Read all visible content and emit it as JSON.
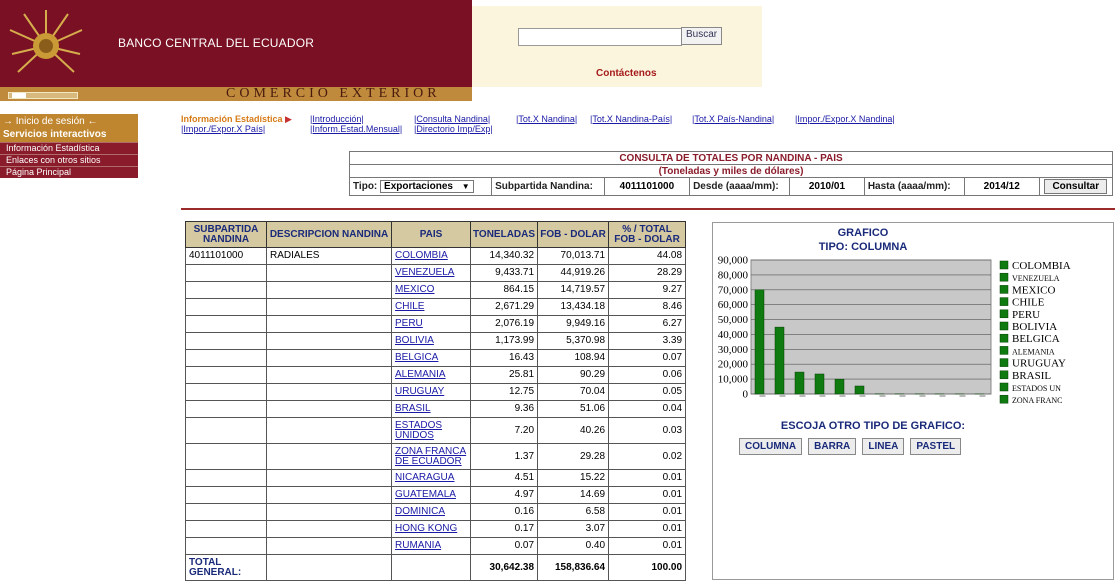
{
  "header": {
    "bank_name": "BANCO CENTRAL DEL ECUADOR",
    "search_button": "Buscar",
    "search_value": "",
    "contact": "Contáctenos",
    "section_title": "COMERCIO EXTERIOR"
  },
  "sidebar": {
    "login": "→ Inicio de sesión ←",
    "services": "Servicios interactivos",
    "items": [
      {
        "label": "Información Estadística"
      },
      {
        "label": "Enlaces con otros sitios"
      },
      {
        "label": "Página Principal"
      }
    ]
  },
  "nav": {
    "current": "Información Estadística",
    "links": {
      "introduccion": "|Introducción|",
      "consulta_nandina": "|Consulta Nandina|",
      "tot_nandina": "|Tot.X Nandina|",
      "tot_nandina_pais": "|Tot.X Nandina-País|",
      "tot_pais_nandina": "|Tot.X País-Nandina|",
      "impor_expor_nandina": "|Impor./Expor.X Nandina|",
      "impor_expor_pais": "|Impor./Expor.X País|",
      "inform_estad": "|Inform.Estad.Mensual|",
      "directorio": "|Directorio Imp/Exp|"
    }
  },
  "consulta": {
    "title": "CONSULTA DE TOTALES POR NANDINA - PAIS",
    "subtitle": "(Toneladas y miles de dólares)",
    "tipo_label": "Tipo:",
    "tipo_value": "Exportaciones",
    "subpartida_label": "Subpartida Nandina:",
    "subpartida_value": "4011101000",
    "desde_label": "Desde (aaaa/mm):",
    "desde_value": "2010/01",
    "hasta_label": "Hasta (aaaa/mm):",
    "hasta_value": "2014/12",
    "button": "Consultar"
  },
  "table": {
    "headers": [
      "SUBPARTIDA NANDINA",
      "DESCRIPCION NANDINA",
      "PAIS",
      "TONELADAS",
      "FOB - DOLAR",
      "% / TOTAL FOB - DOLAR"
    ],
    "rows": [
      {
        "sub": "4011101000",
        "desc": "RADIALES",
        "pais": "COLOMBIA",
        "ton": "14,340.32",
        "fob": "70,013.71",
        "pct": "44.08"
      },
      {
        "sub": "",
        "desc": "",
        "pais": "VENEZUELA",
        "ton": "9,433.71",
        "fob": "44,919.26",
        "pct": "28.29"
      },
      {
        "sub": "",
        "desc": "",
        "pais": "MEXICO",
        "ton": "864.15",
        "fob": "14,719.57",
        "pct": "9.27"
      },
      {
        "sub": "",
        "desc": "",
        "pais": "CHILE",
        "ton": "2,671.29",
        "fob": "13,434.18",
        "pct": "8.46"
      },
      {
        "sub": "",
        "desc": "",
        "pais": "PERU",
        "ton": "2,076.19",
        "fob": "9,949.16",
        "pct": "6.27"
      },
      {
        "sub": "",
        "desc": "",
        "pais": "BOLIVIA",
        "ton": "1,173.99",
        "fob": "5,370.98",
        "pct": "3.39"
      },
      {
        "sub": "",
        "desc": "",
        "pais": "BELGICA",
        "ton": "16.43",
        "fob": "108.94",
        "pct": "0.07"
      },
      {
        "sub": "",
        "desc": "",
        "pais": "ALEMANIA",
        "ton": "25.81",
        "fob": "90.29",
        "pct": "0.06"
      },
      {
        "sub": "",
        "desc": "",
        "pais": "URUGUAY",
        "ton": "12.75",
        "fob": "70.04",
        "pct": "0.05"
      },
      {
        "sub": "",
        "desc": "",
        "pais": "BRASIL",
        "ton": "9.36",
        "fob": "51.06",
        "pct": "0.04"
      },
      {
        "sub": "",
        "desc": "",
        "pais": "ESTADOS UNIDOS",
        "ton": "7.20",
        "fob": "40.26",
        "pct": "0.03"
      },
      {
        "sub": "",
        "desc": "",
        "pais": "ZONA FRANCA DE ECUADOR",
        "ton": "1.37",
        "fob": "29.28",
        "pct": "0.02"
      },
      {
        "sub": "",
        "desc": "",
        "pais": "NICARAGUA",
        "ton": "4.51",
        "fob": "15.22",
        "pct": "0.01"
      },
      {
        "sub": "",
        "desc": "",
        "pais": "GUATEMALA",
        "ton": "4.97",
        "fob": "14.69",
        "pct": "0.01"
      },
      {
        "sub": "",
        "desc": "",
        "pais": "DOMINICA",
        "ton": "0.16",
        "fob": "6.58",
        "pct": "0.01"
      },
      {
        "sub": "",
        "desc": "",
        "pais": "HONG KONG",
        "ton": "0.17",
        "fob": "3.07",
        "pct": "0.01"
      },
      {
        "sub": "",
        "desc": "",
        "pais": "RUMANIA",
        "ton": "0.07",
        "fob": "0.40",
        "pct": "0.01"
      }
    ],
    "total": {
      "label": "TOTAL GENERAL:",
      "ton": "30,642.38",
      "fob": "158,836.64",
      "pct": "100.00"
    }
  },
  "chart_panel": {
    "title": "GRAFICO",
    "subtitle": "TIPO: COLUMNA",
    "prompt": "ESCOJA OTRO TIPO DE GRAFICO:",
    "buttons": [
      "COLUMNA",
      "BARRA",
      "LINEA",
      "PASTEL"
    ]
  },
  "chart_data": {
    "type": "bar",
    "categories": [
      "COLOMBIA",
      "VENEZUELA",
      "MEXICO",
      "CHILE",
      "PERU",
      "BOLIVIA",
      "BELGICA",
      "ALEMANIA",
      "URUGUAY",
      "BRASIL",
      "ESTADOS UN",
      "ZONA FRANC"
    ],
    "values": [
      70013.71,
      44919.26,
      14719.57,
      13434.18,
      9949.16,
      5370.98,
      108.94,
      90.29,
      70.04,
      51.06,
      40.26,
      29.28
    ],
    "ylim": [
      0,
      90000
    ],
    "yticks": [
      "0",
      "10,000",
      "20,000",
      "30,000",
      "40,000",
      "50,000",
      "60,000",
      "70,000",
      "80,000",
      "90,000"
    ],
    "grid": true,
    "legend": "right",
    "colors": {
      "bar": "#0f7a0f",
      "plot_bg": "#c8c8c8"
    }
  }
}
